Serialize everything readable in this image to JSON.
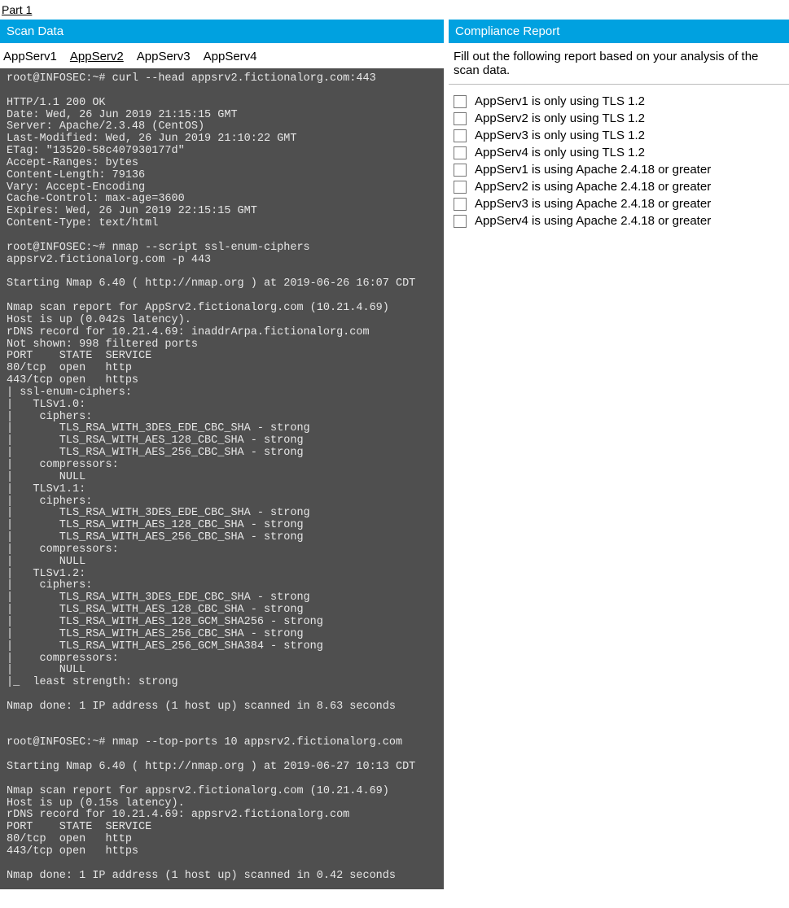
{
  "part_label": "Part 1",
  "scan_panel": {
    "title": "Scan Data",
    "tabs": [
      "AppServ1",
      "AppServ2",
      "AppServ3",
      "AppServ4"
    ],
    "active_tab_index": 1
  },
  "terminal_output": "root@INFOSEC:~# curl --head appsrv2.fictionalorg.com:443\n\nHTTP/1.1 200 OK\nDate: Wed, 26 Jun 2019 21:15:15 GMT\nServer: Apache/2.3.48 (CentOS)\nLast-Modified: Wed, 26 Jun 2019 21:10:22 GMT\nETag: \"13520-58c407930177d\"\nAccept-Ranges: bytes\nContent-Length: 79136\nVary: Accept-Encoding\nCache-Control: max-age=3600\nExpires: Wed, 26 Jun 2019 22:15:15 GMT\nContent-Type: text/html\n\nroot@INFOSEC:~# nmap --script ssl-enum-ciphers\nappsrv2.fictionalorg.com -p 443\n\nStarting Nmap 6.40 ( http://nmap.org ) at 2019-06-26 16:07 CDT\n\nNmap scan report for AppSrv2.fictionalorg.com (10.21.4.69)\nHost is up (0.042s latency).\nrDNS record for 10.21.4.69: inaddrArpa.fictionalorg.com\nNot shown: 998 filtered ports\nPORT    STATE  SERVICE\n80/tcp  open   http\n443/tcp open   https\n| ssl-enum-ciphers:\n|   TLSv1.0:\n|    ciphers:\n|       TLS_RSA_WITH_3DES_EDE_CBC_SHA - strong\n|       TLS_RSA_WITH_AES_128_CBC_SHA - strong\n|       TLS_RSA_WITH_AES_256_CBC_SHA - strong\n|    compressors:\n|       NULL\n|   TLSv1.1:\n|    ciphers:\n|       TLS_RSA_WITH_3DES_EDE_CBC_SHA - strong\n|       TLS_RSA_WITH_AES_128_CBC_SHA - strong\n|       TLS_RSA_WITH_AES_256_CBC_SHA - strong\n|    compressors:\n|       NULL\n|   TLSv1.2:\n|    ciphers:\n|       TLS_RSA_WITH_3DES_EDE_CBC_SHA - strong\n|       TLS_RSA_WITH_AES_128_CBC_SHA - strong\n|       TLS_RSA_WITH_AES_128_GCM_SHA256 - strong\n|       TLS_RSA_WITH_AES_256_CBC_SHA - strong\n|       TLS_RSA_WITH_AES_256_GCM_SHA384 - strong\n|    compressors:\n|       NULL\n|_  least strength: strong\n\nNmap done: 1 IP address (1 host up) scanned in 8.63 seconds\n\n\nroot@INFOSEC:~# nmap --top-ports 10 appsrv2.fictionalorg.com\n\nStarting Nmap 6.40 ( http://nmap.org ) at 2019-06-27 10:13 CDT\n\nNmap scan report for appsrv2.fictionalorg.com (10.21.4.69)\nHost is up (0.15s latency).\nrDNS record for 10.21.4.69: appsrv2.fictionalorg.com\nPORT    STATE  SERVICE\n80/tcp  open   http\n443/tcp open   https\n\nNmap done: 1 IP address (1 host up) scanned in 0.42 seconds",
  "compliance_panel": {
    "title": "Compliance Report",
    "instruction": "Fill out the following report based on your analysis of the scan data.",
    "items": [
      "AppServ1 is only using TLS 1.2",
      "AppServ2 is only using TLS 1.2",
      "AppServ3 is only using TLS 1.2",
      "AppServ4 is only using TLS 1.2",
      "AppServ1 is using Apache 2.4.18 or greater",
      "AppServ2 is using Apache 2.4.18 or greater",
      "AppServ3 is using Apache 2.4.18 or greater",
      "AppServ4 is using Apache 2.4.18 or greater"
    ]
  }
}
